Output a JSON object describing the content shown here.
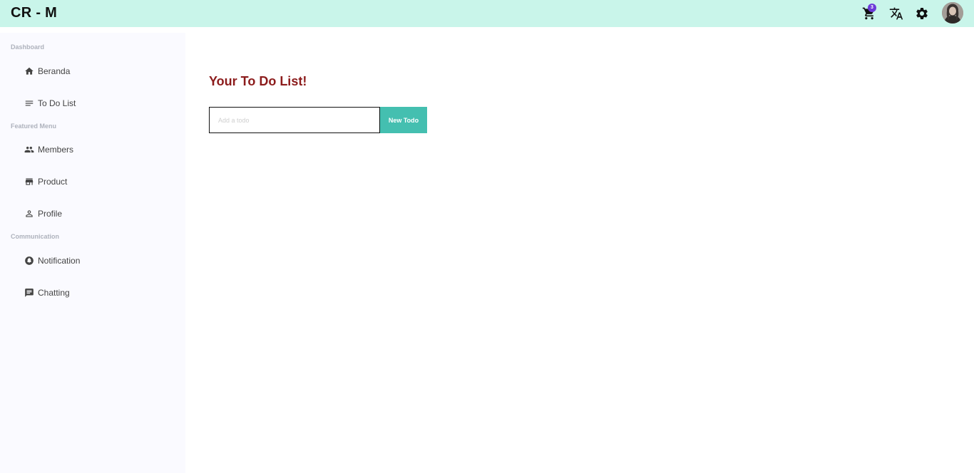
{
  "header": {
    "brand": "CR - M",
    "cart_count": "3"
  },
  "sidebar": {
    "sections": [
      {
        "label": "Dashboard"
      },
      {
        "label": "Featured Menu"
      },
      {
        "label": "Communication"
      }
    ],
    "items": [
      {
        "label": "Beranda",
        "icon": "home-icon"
      },
      {
        "label": "To Do List",
        "icon": "list-icon"
      },
      {
        "label": "Members",
        "icon": "people-icon"
      },
      {
        "label": "Product",
        "icon": "store-icon"
      },
      {
        "label": "Profile",
        "icon": "person-icon"
      },
      {
        "label": "Notification",
        "icon": "bell-icon"
      },
      {
        "label": "Chatting",
        "icon": "chat-icon"
      }
    ]
  },
  "main": {
    "title": "Your To Do List!",
    "input_placeholder": "Add a todo",
    "input_value": "",
    "button_label": "New Todo"
  },
  "colors": {
    "header_bg": "#c9f5ea",
    "sidebar_bg": "#fafaff",
    "title": "#8c1c1c",
    "button_bg": "#44bfb0",
    "badge_bg": "#6c3bd8"
  }
}
